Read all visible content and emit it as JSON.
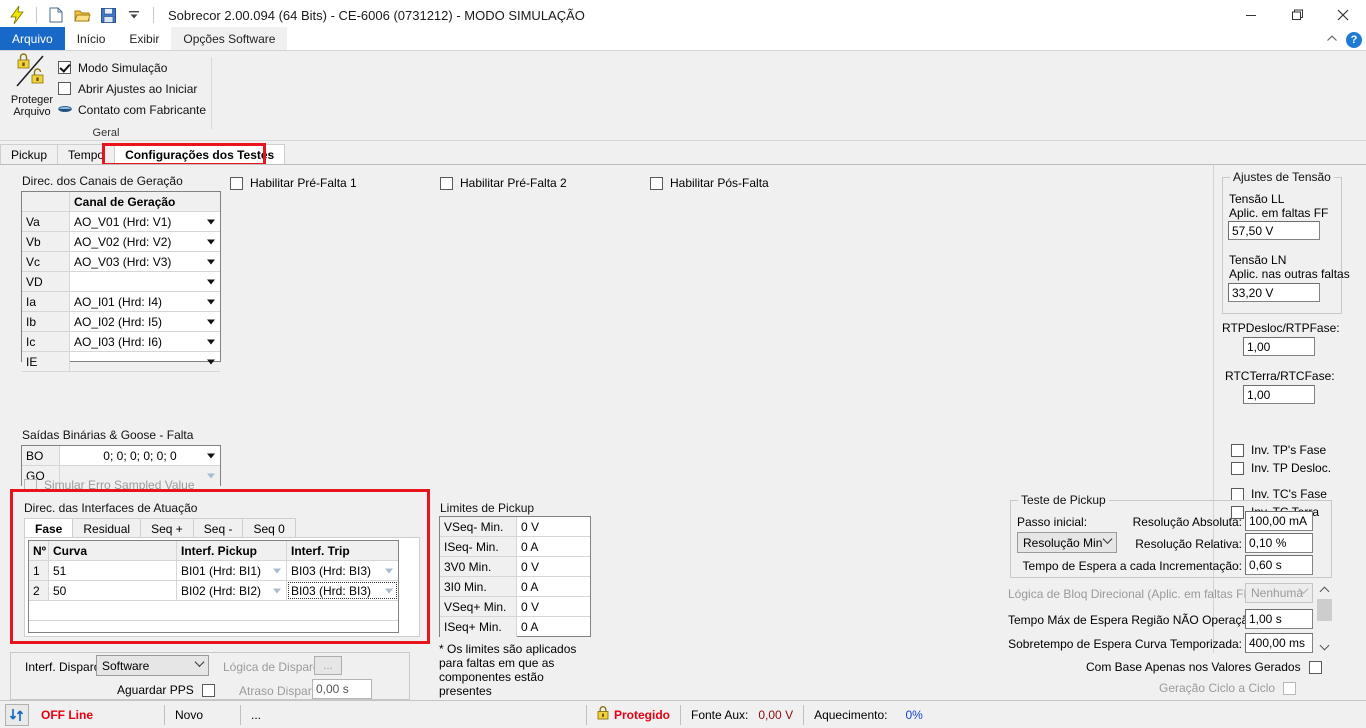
{
  "window": {
    "title": "Sobrecor 2.00.094 (64 Bits) - CE-6006 (0731212) - MODO SIMULAÇÃO",
    "qat": [
      {
        "name": "lightning-icon",
        "glyph": "⚡"
      },
      {
        "name": "new-file-icon",
        "glyph": "🗋"
      },
      {
        "name": "open-folder-icon",
        "glyph": "🗁"
      },
      {
        "name": "save-disk-icon",
        "glyph": "🖫"
      },
      {
        "name": "customize-qat-icon",
        "glyph": "▾"
      }
    ],
    "controls": {
      "minimize": "minimize-icon",
      "maximize": "maximize-icon",
      "close": "close-icon"
    }
  },
  "ribbon": {
    "tabs": [
      {
        "label": "Arquivo",
        "state": "file"
      },
      {
        "label": "Início",
        "state": "normal"
      },
      {
        "label": "Exibir",
        "state": "normal"
      },
      {
        "label": "Opções Software",
        "state": "active"
      }
    ],
    "collapse_icon": "chevron-up-icon",
    "help_icon": "help-icon",
    "help_glyph": "?",
    "group": {
      "label": "Geral",
      "protect_button": {
        "line1": "Proteger",
        "line2": "Arquivo"
      },
      "options": [
        {
          "label": "Modo Simulação",
          "checked": true,
          "type": "checkbox"
        },
        {
          "label": "Abrir Ajustes ao Iniciar",
          "checked": false,
          "type": "checkbox"
        },
        {
          "label": "Contato com Fabricante",
          "checked": false,
          "type": "link"
        }
      ]
    }
  },
  "page_tabs": [
    {
      "label": "Pickup",
      "active": false
    },
    {
      "label": "Tempo",
      "active": false
    },
    {
      "label": "Configurações dos Testes",
      "active": true
    }
  ],
  "generation_channels": {
    "group_label": "Direc. dos Canais de Geração",
    "header": [
      "",
      "Canal de Geração"
    ],
    "rows": [
      {
        "key": "Va",
        "value": "AO_V01 (Hrd: V1)"
      },
      {
        "key": "Vb",
        "value": "AO_V02 (Hrd: V2)"
      },
      {
        "key": "Vc",
        "value": "AO_V03 (Hrd: V3)"
      },
      {
        "key": "VD",
        "value": ""
      },
      {
        "key": "Ia",
        "value": "AO_I01 (Hrd: I4)"
      },
      {
        "key": "Ib",
        "value": "AO_I02 (Hrd: I5)"
      },
      {
        "key": "Ic",
        "value": "AO_I03 (Hrd: I6)"
      },
      {
        "key": "IE",
        "value": ""
      }
    ]
  },
  "fault_toggles": [
    {
      "label": "Habilitar Pré-Falta 1",
      "checked": false
    },
    {
      "label": "Habilitar Pré-Falta 2",
      "checked": false
    },
    {
      "label": "Habilitar Pós-Falta",
      "checked": false
    }
  ],
  "binary_outputs": {
    "group_label": "Saídas Binárias & Goose - Falta",
    "rows": [
      {
        "key": "BO",
        "value": "0; 0; 0; 0; 0; 0",
        "enabled": true
      },
      {
        "key": "GO",
        "value": "",
        "enabled": false
      }
    ],
    "simulate_error": {
      "label": "Simular Erro Sampled Value",
      "checked": false,
      "enabled": false
    }
  },
  "actuation_interfaces": {
    "group_label": "Direc. das Interfaces de Atuação",
    "tabs": [
      {
        "label": "Fase",
        "active": true
      },
      {
        "label": "Residual",
        "active": false
      },
      {
        "label": "Seq +",
        "active": false
      },
      {
        "label": "Seq -",
        "active": false
      },
      {
        "label": "Seq 0",
        "active": false
      }
    ],
    "columns": [
      "Nº",
      "Curva",
      "Interf. Pickup",
      "Interf. Trip"
    ],
    "rows": [
      {
        "num": "1",
        "curva": "51",
        "pickup": "BI01 (Hrd: BI1)",
        "trip": "BI03 (Hrd: BI3)",
        "focused": false
      },
      {
        "num": "2",
        "curva": "50",
        "pickup": "BI02 (Hrd: BI2)",
        "trip": "BI03 (Hrd: BI3)",
        "focused": true
      }
    ]
  },
  "pickup_limits": {
    "group_label": "Limites de Pickup",
    "rows": [
      {
        "key": "VSeq- Min.",
        "value": "0 V"
      },
      {
        "key": "ISeq- Min.",
        "value": "0 A"
      },
      {
        "key": "3V0 Min.",
        "value": "0 V"
      },
      {
        "key": "3I0 Min.",
        "value": "0 A"
      },
      {
        "key": "VSeq+ Min.",
        "value": "0 V"
      },
      {
        "key": "ISeq+ Min.",
        "value": "0 A"
      }
    ],
    "note": "* Os limites são aplicados para faltas em que as componentes estão presentes"
  },
  "voltage_settings": {
    "group_label": "Ajustes de Tensão",
    "ll_label_1": "Tensão LL",
    "ll_label_2": "Aplic. em faltas FF",
    "ll_value": "57,50 V",
    "ln_label_1": "Tensão LN",
    "ln_label_2": "Aplic. nas outras faltas",
    "ln_value": "33,20 V",
    "rtp_label": "RTPDesloc/RTPFase:",
    "rtp_value": "1,00",
    "rtc_label": "RTCTerra/RTCFase:",
    "rtc_value": "1,00",
    "inversions": [
      {
        "label": "Inv. TP's Fase",
        "checked": false
      },
      {
        "label": "Inv. TP Desloc.",
        "checked": false
      },
      {
        "label": "Inv. TC's Fase",
        "checked": false
      },
      {
        "label": "Inv. TC Terra",
        "checked": false
      }
    ]
  },
  "pickup_test": {
    "group_label": "Teste de Pickup",
    "passo_label": "Passo inicial:",
    "passo_value": "Resolução Min",
    "res_abs_label": "Resolução Absoluta:",
    "res_abs_value": "100,00 mA",
    "res_rel_label": "Resolução Relativa:",
    "res_rel_value": "0,10 %",
    "tempo_espera_label": "Tempo de Espera a cada Incrementação:",
    "tempo_espera_value": "0,60 s",
    "logica_bloq_label": "Lógica de Bloq Direcional (Aplic. em faltas FF):",
    "logica_bloq_value": "Nenhuma",
    "tempo_max_label": "Tempo Máx de Espera Região NÃO Operação:",
    "tempo_max_value": "1,00 s",
    "sobretempo_label": "Sobretempo de Espera Curva Temporizada:",
    "sobretempo_value": "400,00 ms",
    "com_base_label": "Com Base Apenas nos Valores Gerados",
    "com_base_checked": false,
    "geracao_label": "Geração Ciclo a Ciclo",
    "geracao_checked": false,
    "scroll_up_icon": "scroll-up-icon",
    "scroll_down_icon": "scroll-down-icon"
  },
  "trigger": {
    "interf_label": "Interf. Disparo",
    "interf_value": "Software",
    "logica_label": "Lógica de Disparo",
    "logica_button": "...",
    "aguardar_label": "Aguardar PPS",
    "aguardar_checked": false,
    "atraso_label": "Atraso Disparo",
    "atraso_value": "0,00 s"
  },
  "statusbar": {
    "connection_icon": "sync-icon",
    "connection_status": "OFF Line",
    "file_status": "Novo",
    "extra": "...",
    "lock_icon": "lock-icon",
    "protected": "Protegido",
    "fonte_aux_label": "Fonte Aux:",
    "fonte_aux_value": "0,00 V",
    "aquecimento_label": "Aquecimento:",
    "aquecimento_value": "0%"
  },
  "colors": {
    "accent_blue": "#1868c8",
    "highlight_red": "#e8131b",
    "status_red": "#e60012",
    "status_blue": "#1546c8"
  }
}
